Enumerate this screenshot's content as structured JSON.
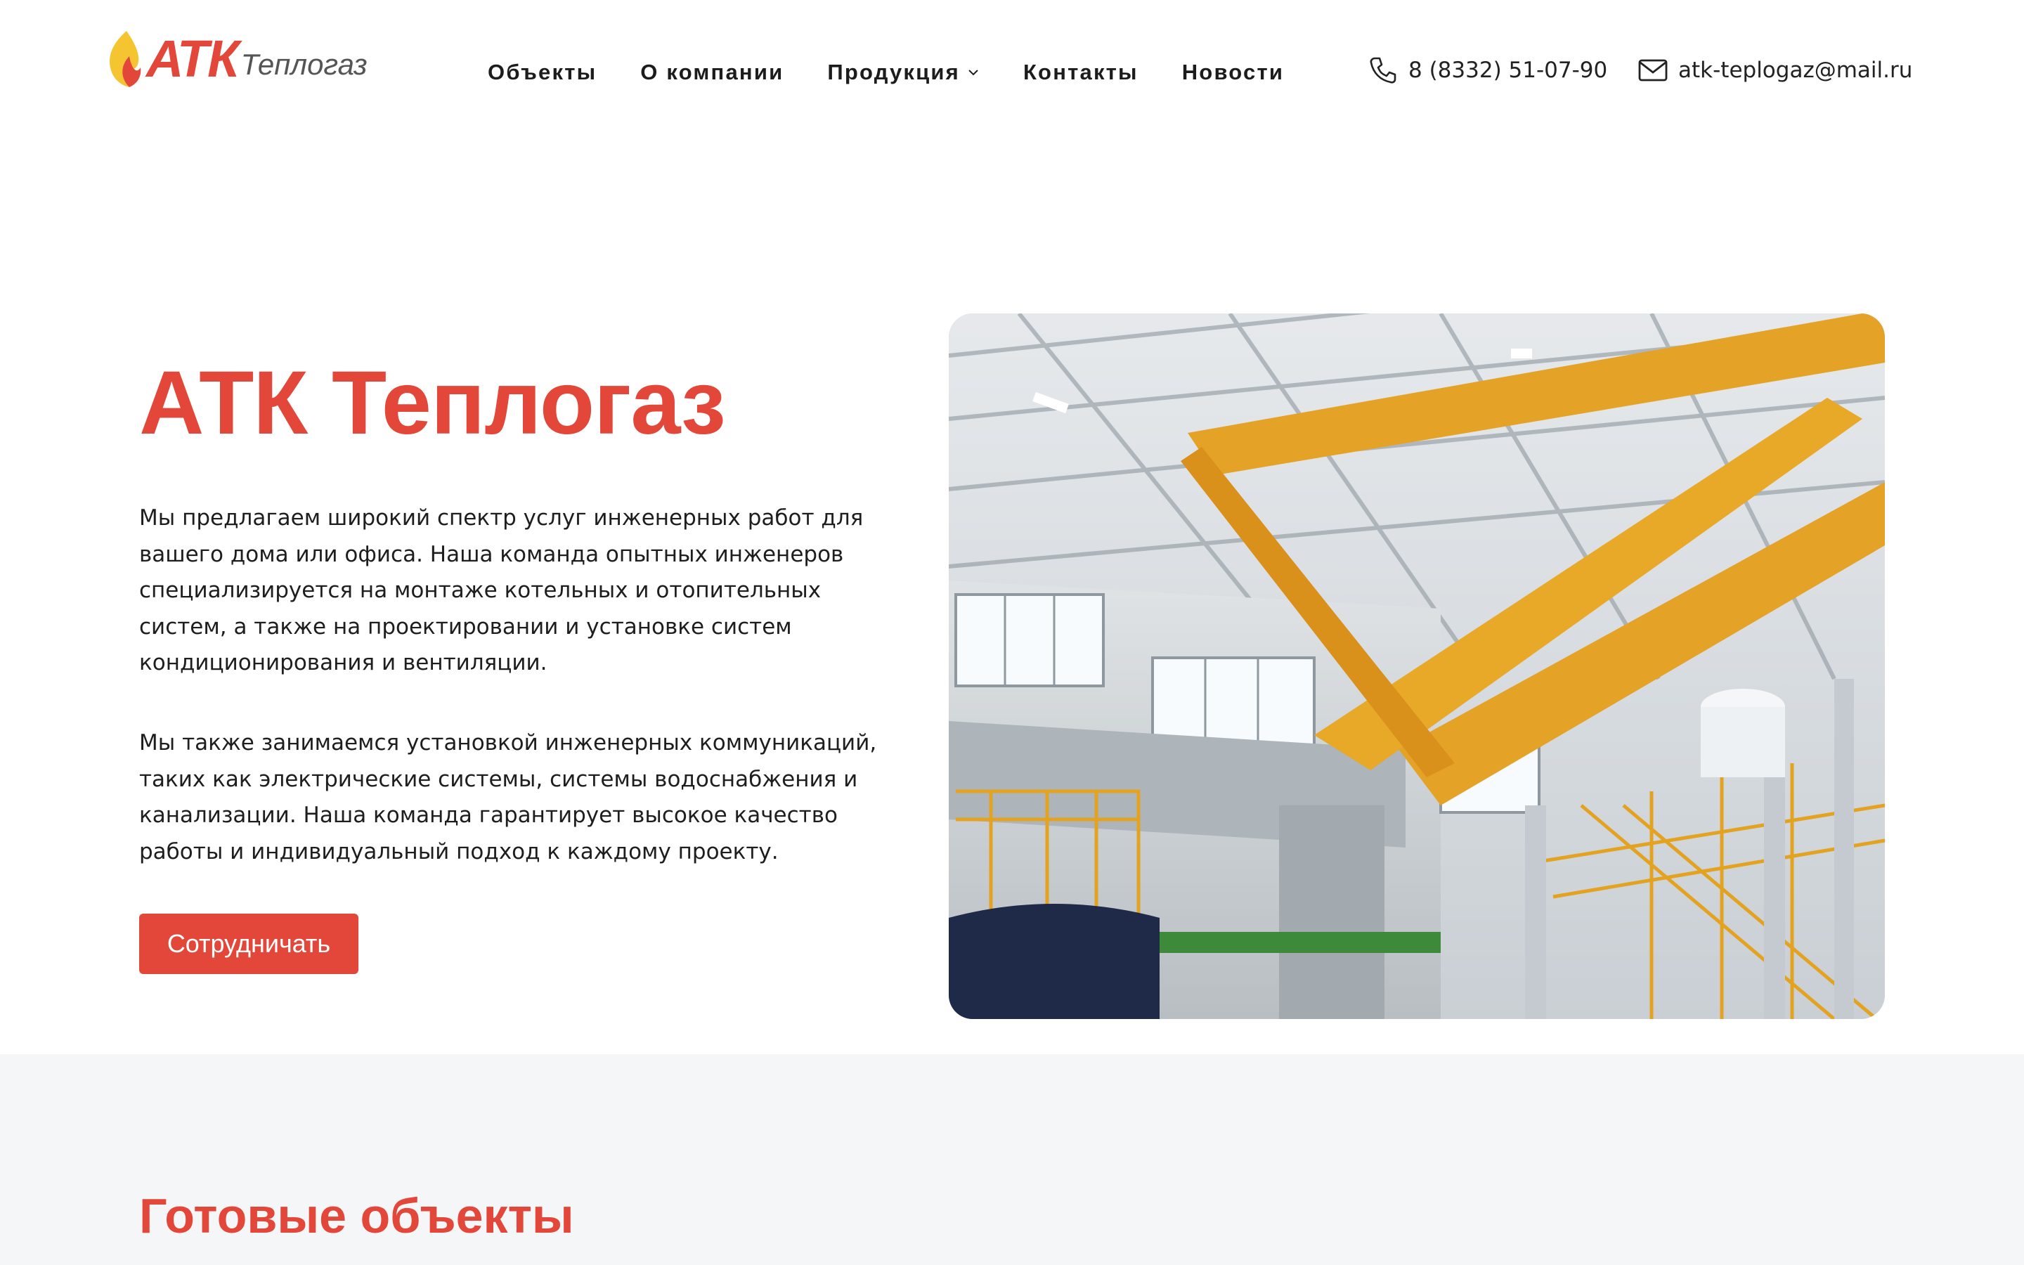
{
  "brand": {
    "logo_main": "АТК",
    "logo_sub": "Теплогаз",
    "accent_color": "#e2473a"
  },
  "nav": {
    "items": [
      {
        "label": "Объекты"
      },
      {
        "label": "О компании"
      },
      {
        "label": "Продукция",
        "has_dropdown": true
      },
      {
        "label": "Контакты"
      },
      {
        "label": "Новости"
      }
    ]
  },
  "contacts": {
    "phone": "8 (8332) 51-07-90",
    "phone_icon": "phone-icon",
    "email": "atk-teplogaz@mail.ru",
    "email_icon": "mail-icon"
  },
  "hero": {
    "title": "АТК Теплогаз",
    "paragraph1": "Мы предлагаем широкий спектр услуг инженерных работ для вашего дома или офиса. Наша команда опытных инженеров специализируется на монтаже котельных и отопительных систем, а также на проектировании и установке систем кондиционирования и вентиляции.",
    "paragraph2": "Мы также занимаемся установкой инженерных коммуникаций, таких как электрические системы, системы водоснабжения и канализации. Наша команда гарантирует высокое качество работы и индивидуальный подход к каждому проекту.",
    "cta_label": "Сотрудничать",
    "image": "industrial-hall-photo"
  },
  "objects_section": {
    "title": "Готовые объекты"
  }
}
